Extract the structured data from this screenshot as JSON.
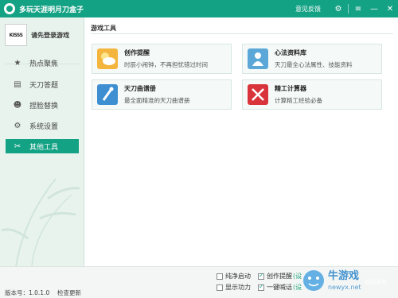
{
  "titlebar": {
    "title": "多玩天涯明月刀盒子",
    "feedback": "意见反馈",
    "settings_icon": "gear-icon",
    "menu_icon": "menu-icon",
    "minimize_icon": "minimize-icon",
    "close_icon": "close-icon",
    "accent_color": "#14a285"
  },
  "sidebar": {
    "avatar_text": "KISSS",
    "login_text": "请先登录游戏",
    "items": [
      {
        "label": "热点聚焦",
        "icon": "star-icon"
      },
      {
        "label": "天刀答题",
        "icon": "document-icon"
      },
      {
        "label": "捏脸替换",
        "icon": "mask-icon"
      },
      {
        "label": "系统设置",
        "icon": "gear-icon"
      },
      {
        "label": "其他工具",
        "icon": "tools-icon",
        "active": true
      }
    ]
  },
  "main": {
    "section_title": "游戏工具",
    "cards": [
      {
        "title": "创作提醒",
        "desc": "时辰小闹钟，不再担忧错过时间",
        "icon": "weather-icon"
      },
      {
        "title": "心法资料库",
        "desc": "天刀最全心法属性、技能资料",
        "icon": "book-icon"
      },
      {
        "title": "天刀曲谱册",
        "desc": "最全面精准的天刀曲谱册",
        "icon": "music-icon"
      },
      {
        "title": "精工计算器",
        "desc": "计算精工经验必备",
        "icon": "crossed-swords-icon"
      }
    ]
  },
  "statusbar": {
    "version": "版本号：1.0.1.0",
    "check_update": "检查更新",
    "options": [
      {
        "label": "纯净启动",
        "checked": false
      },
      {
        "label": "创作提醒",
        "hint": "(设",
        "checked": true
      },
      {
        "label": "显示功力",
        "checked": false
      },
      {
        "label": "一键喊话",
        "hint": "(设",
        "checked": true
      }
    ],
    "watermark": "牛游戏",
    "watermark_url": "newyx.net",
    "watermark_sub": "启动游戏"
  }
}
